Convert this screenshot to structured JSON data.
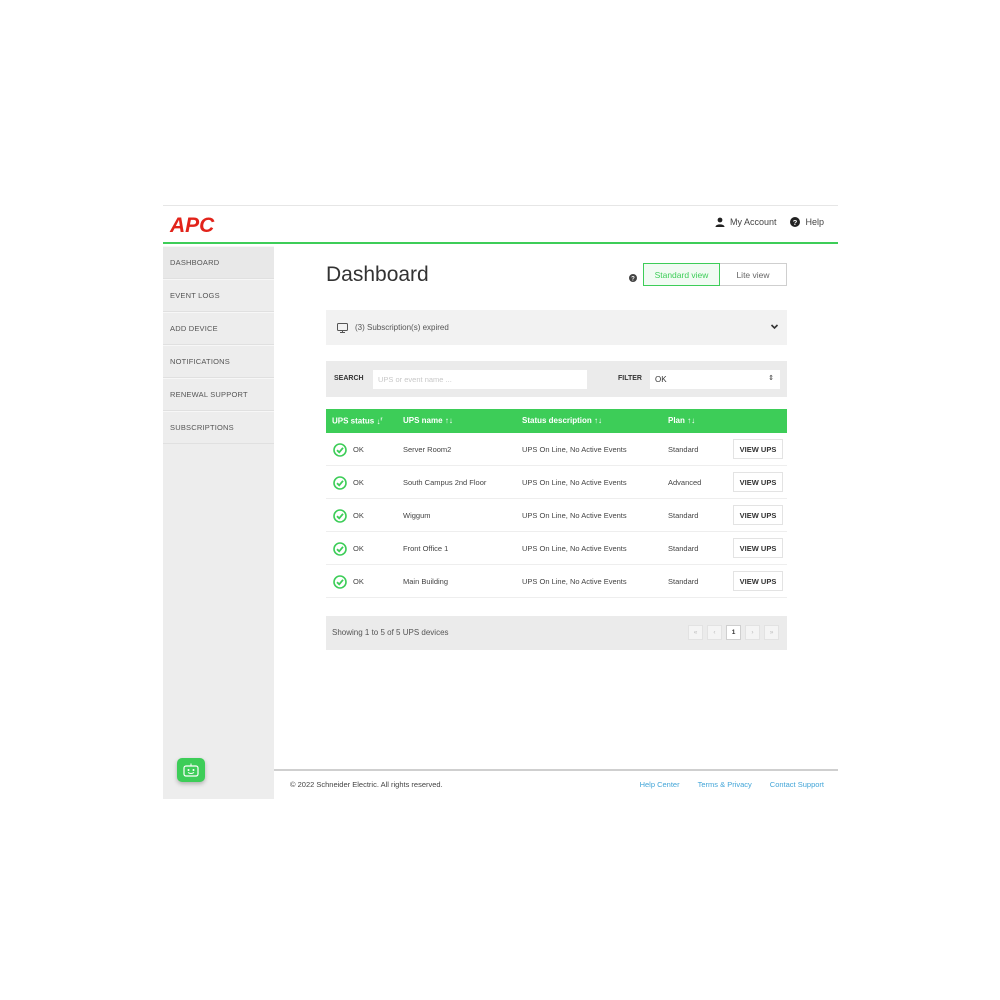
{
  "header": {
    "logo_text": "APC",
    "my_account_label": "My Account",
    "help_label": "Help"
  },
  "sidebar": {
    "items": [
      {
        "label": "DASHBOARD"
      },
      {
        "label": "EVENT LOGS"
      },
      {
        "label": "ADD DEVICE"
      },
      {
        "label": "NOTIFICATIONS"
      },
      {
        "label": "RENEWAL SUPPORT"
      },
      {
        "label": "SUBSCRIPTIONS"
      }
    ]
  },
  "main": {
    "title": "Dashboard",
    "view_toggle": {
      "standard_label": "Standard view",
      "lite_label": "Lite view",
      "active": "standard"
    },
    "subscription_notice": "(3) Subscription(s) expired",
    "search": {
      "label": "SEARCH",
      "placeholder": "UPS or event name ..."
    },
    "filter": {
      "label": "FILTER",
      "selected": "OK"
    },
    "table": {
      "columns": [
        {
          "label": "UPS status",
          "sort_icon": "sort-desc-icon"
        },
        {
          "label": "UPS name",
          "sort_icon": "sort-icon"
        },
        {
          "label": "Status description",
          "sort_icon": "sort-icon"
        },
        {
          "label": "Plan",
          "sort_icon": "sort-icon"
        }
      ],
      "rows": [
        {
          "status": "OK",
          "name": "Server Room2",
          "description": "UPS On Line, No Active Events",
          "plan": "Standard",
          "action": "VIEW UPS"
        },
        {
          "status": "OK",
          "name": "South Campus 2nd Floor",
          "description": "UPS On Line, No Active Events",
          "plan": "Advanced",
          "action": "VIEW UPS"
        },
        {
          "status": "OK",
          "name": "Wiggum",
          "description": "UPS On Line, No Active Events",
          "plan": "Standard",
          "action": "VIEW UPS"
        },
        {
          "status": "OK",
          "name": "Front Office 1",
          "description": "UPS On Line, No Active Events",
          "plan": "Standard",
          "action": "VIEW UPS"
        },
        {
          "status": "OK",
          "name": "Main Building",
          "description": "UPS On Line, No Active Events",
          "plan": "Standard",
          "action": "VIEW UPS"
        }
      ]
    },
    "pagination": {
      "summary": "Showing 1 to 5 of 5 UPS devices",
      "first": "«",
      "prev": "‹",
      "current_page": "1",
      "next": "›",
      "last": "»"
    }
  },
  "footer": {
    "copyright": "© 2022 Schneider Electric. All rights reserved.",
    "links": [
      "Help Center",
      "Terms & Privacy",
      "Contact Support"
    ]
  },
  "colors": {
    "accent_green": "#3dcd58",
    "brand_red": "#e2231a",
    "link_blue": "#42a5d8"
  }
}
